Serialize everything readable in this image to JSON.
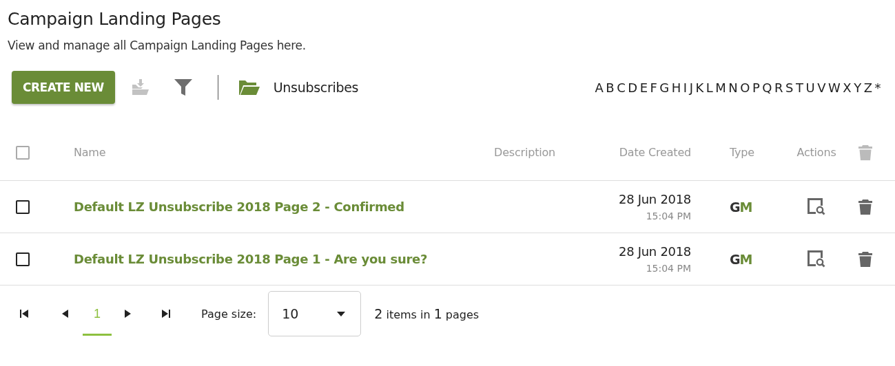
{
  "title": "Campaign Landing Pages",
  "subtitle": "View and manage all Campaign Landing Pages here.",
  "toolbar": {
    "create_label": "CREATE NEW",
    "export_disabled": true,
    "folder_label": "Unsubscribes",
    "letters": [
      "A",
      "B",
      "C",
      "D",
      "E",
      "F",
      "G",
      "H",
      "I",
      "J",
      "K",
      "L",
      "M",
      "N",
      "O",
      "P",
      "Q",
      "R",
      "S",
      "T",
      "U",
      "V",
      "W",
      "X",
      "Y",
      "Z",
      "*"
    ]
  },
  "table": {
    "select_all": {
      "checked": false,
      "disabled": true
    },
    "delete_all_disabled": true,
    "columns": [
      "Name",
      "Description",
      "Date Created",
      "Type",
      "Actions"
    ],
    "rows": [
      {
        "checked": false,
        "name": "Default LZ Unsubscribe 2018 Page 2 - Confirmed",
        "date": "28 Jun 2018",
        "time": "15:04 PM",
        "type": "GM"
      },
      {
        "checked": false,
        "name": "Default LZ Unsubscribe 2018 Page 1 - Are you sure?",
        "date": "28 Jun 2018",
        "time": "15:04 PM",
        "type": "GM"
      }
    ]
  },
  "pager": {
    "pages": [
      {
        "label": "1",
        "selected": true
      }
    ],
    "page_size_label": "Page size:",
    "page_size": "10",
    "summary": "**2** items in **1** pages"
  }
}
